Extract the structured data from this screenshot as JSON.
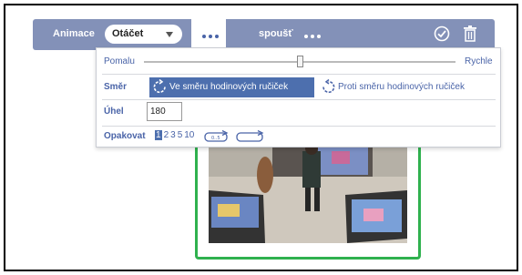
{
  "toolbar": {
    "animation_label": "Animace",
    "animation_value": "Otáčet",
    "trigger_label": "spoušť",
    "icons": [
      "dots-icon",
      "check-circle-icon",
      "trash-icon"
    ]
  },
  "panel": {
    "speed": {
      "slow_label": "Pomalu",
      "fast_label": "Rychle",
      "level": 0.5
    },
    "direction": {
      "label": "Směr",
      "options": [
        "Ve směru hodinových ručiček",
        "Proti směru hodinových ručiček"
      ],
      "selected": "Ve směru hodinových ručiček"
    },
    "angle": {
      "label": "Úhel",
      "value": "180"
    },
    "repeat": {
      "label": "Opakovat",
      "options": [
        "1",
        "2",
        "3",
        "5",
        "10"
      ],
      "selected": "1"
    }
  },
  "colors": {
    "toolbar_bg": "#8391b8",
    "accent": "#4d6fae",
    "card_border": "#2fb14e"
  }
}
